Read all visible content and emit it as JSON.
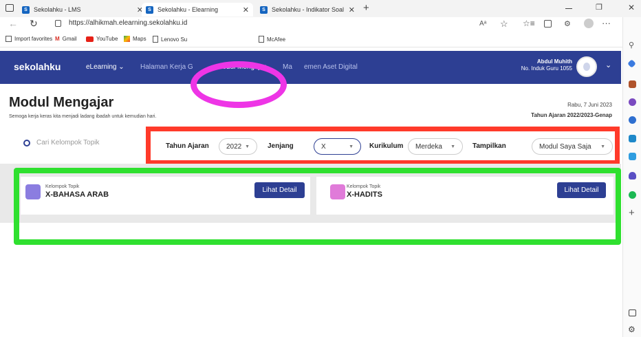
{
  "browser": {
    "tabs": [
      {
        "title": "Sekolahku - LMS"
      },
      {
        "title": "Sekolahku - Elearning"
      },
      {
        "title": "Sekolahku - Indikator Soal"
      }
    ],
    "new_tab": "+",
    "url": "https://alhikmah.elearning.sekolahku.id",
    "favorites": [
      "Import favorites",
      "Gmail",
      "YouTube",
      "Maps",
      "Lenovo Su",
      "McAfee"
    ]
  },
  "app": {
    "logo": "sekolahku",
    "nav": [
      "eLearning",
      "Halaman Kerja G",
      "Modul Mengajar",
      "Ma",
      "emen Aset Digital"
    ],
    "user_name": "Abdul Muhith",
    "user_id": "No. Induk Guru 1055"
  },
  "page": {
    "title": "Modul Mengajar",
    "subtitle": "Semoga kerja keras kita menjadi ladang ibadah untuk kemudian hari.",
    "date": "Rabu, 7 Juni 2023",
    "academic_year": "Tahun Ajaran 2022/2023-Genap"
  },
  "filter": {
    "search_placeholder": "Cari Kelompok Topik",
    "year_label": "Tahun Ajaran",
    "year_value": "2022",
    "level_label": "Jenjang",
    "level_value": "X",
    "curriculum_label": "Kurikulum",
    "curriculum_value": "Merdeka",
    "show_label": "Tampilkan",
    "show_value": "Modul Saya Saja"
  },
  "cards": [
    {
      "kicker": "Kelompok Topik",
      "title": "X-BAHASA ARAB",
      "button": "Lihat Detail"
    },
    {
      "kicker": "Kelompok Topik",
      "title": "X-HADITS",
      "button": "Lihat Detail"
    }
  ],
  "colors": {
    "nav_bg": "#2d3f93",
    "highlight_magenta": "#ee35e6",
    "highlight_red": "#ff3a2a",
    "highlight_green": "#2fe02f"
  }
}
